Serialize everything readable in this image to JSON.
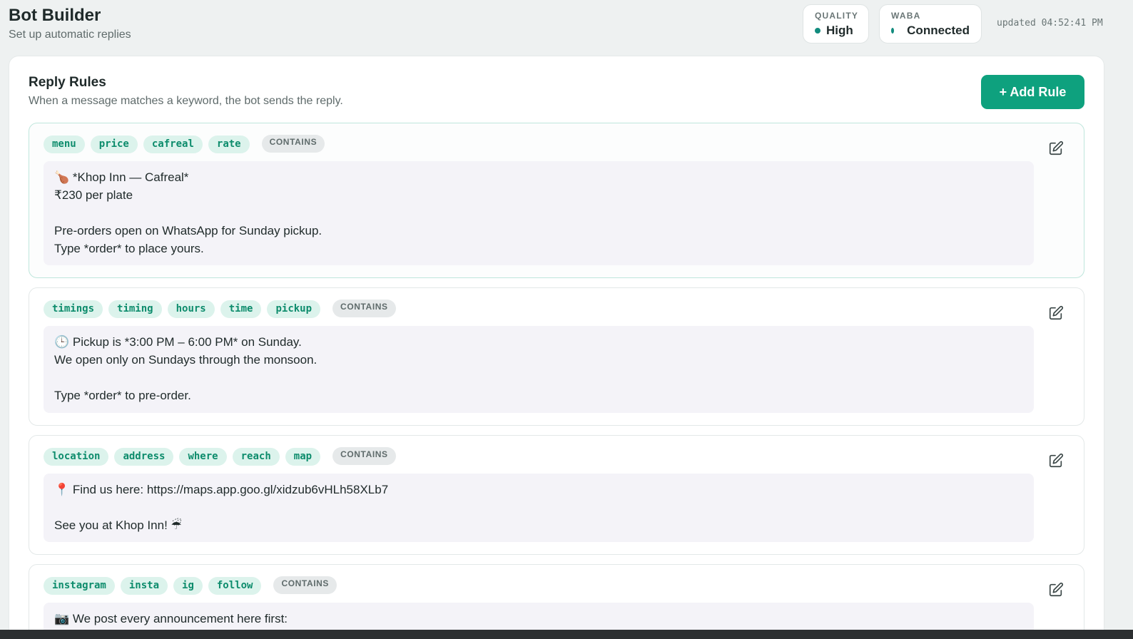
{
  "app": {
    "title": "Bot Builder",
    "subtitle": "Set up automatic replies"
  },
  "status": {
    "quality_label": "QUALITY",
    "quality_value": "High",
    "waba_label": "WABA",
    "waba_value": "Connected",
    "updated": "updated 04:52:41 PM",
    "status_color": "#128c7e"
  },
  "rules_panel": {
    "title": "Reply Rules",
    "subtitle": "When a message matches a keyword, the bot sends the reply.",
    "add_button": "+ Add Rule",
    "accent_color": "#0ea17e"
  },
  "rules": [
    {
      "keywords": [
        "menu",
        "price",
        "cafreal",
        "rate"
      ],
      "match": "CONTAINS",
      "reply": "🍗 *Khop Inn — Cafreal*\n₹230 per plate\n\nPre-orders open on WhatsApp for Sunday pickup.\nType *order* to place yours.",
      "edit_icon": "edit-icon"
    },
    {
      "keywords": [
        "timings",
        "timing",
        "hours",
        "time",
        "pickup"
      ],
      "match": "CONTAINS",
      "reply": "🕒 Pickup is *3:00 PM – 6:00 PM* on Sunday.\nWe open only on Sundays through the monsoon.\n\nType *order* to pre-order.",
      "edit_icon": "edit-icon"
    },
    {
      "keywords": [
        "location",
        "address",
        "where",
        "reach",
        "map"
      ],
      "match": "CONTAINS",
      "reply": "📍 Find us here: https://maps.app.goo.gl/xidzub6vHLh58XLb7\n\nSee you at Khop Inn! ☔",
      "edit_icon": "edit-icon"
    },
    {
      "keywords": [
        "instagram",
        "insta",
        "ig",
        "follow"
      ],
      "match": "CONTAINS",
      "reply": "📷 We post every announcement here first:",
      "edit_icon": "edit-icon"
    }
  ]
}
